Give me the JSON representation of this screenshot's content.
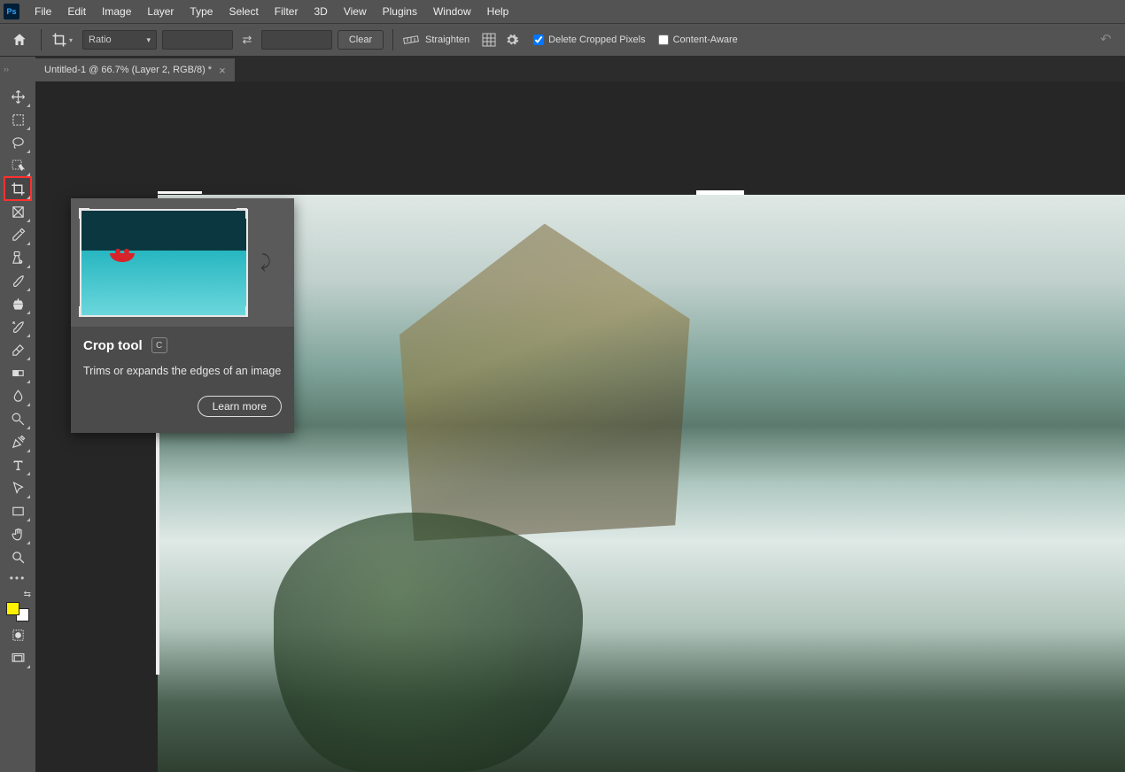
{
  "app": {
    "logo": "Ps"
  },
  "menu": [
    "File",
    "Edit",
    "Image",
    "Layer",
    "Type",
    "Select",
    "Filter",
    "3D",
    "View",
    "Plugins",
    "Window",
    "Help"
  ],
  "options": {
    "ratio_label": "Ratio",
    "clear_label": "Clear",
    "straighten_label": "Straighten",
    "delete_cropped_label": "Delete Cropped Pixels",
    "delete_cropped_checked": true,
    "content_aware_label": "Content-Aware",
    "content_aware_checked": false
  },
  "tab": {
    "title": "Untitled-1 @ 66.7% (Layer 2, RGB/8) *"
  },
  "tooltip": {
    "title": "Crop tool",
    "shortcut": "C",
    "description": "Trims or expands the edges of an image",
    "learn_more": "Learn more"
  },
  "tools": {
    "selected": "crop"
  }
}
